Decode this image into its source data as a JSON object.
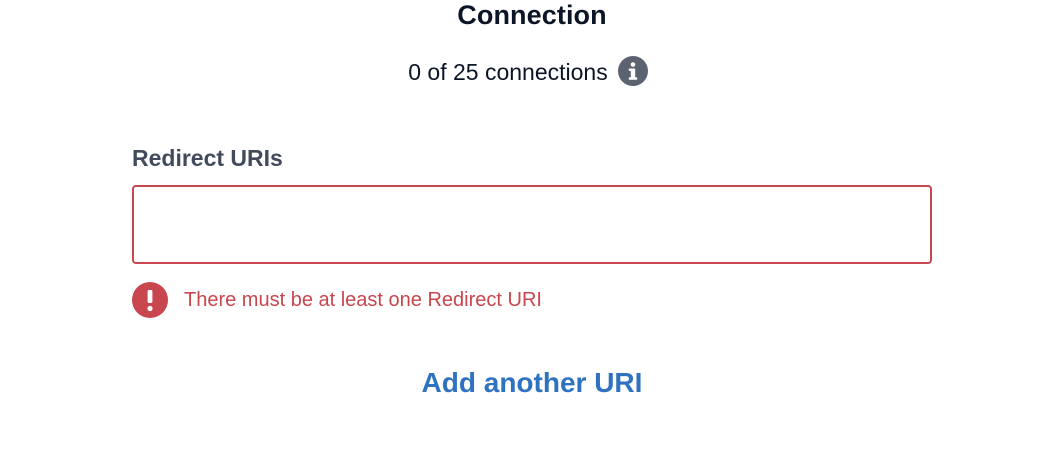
{
  "page": {
    "title": "Connection"
  },
  "usage": {
    "text": "0 of 25 connections",
    "icon": "info-icon"
  },
  "redirect_uris": {
    "label": "Redirect URIs",
    "value": "",
    "placeholder": "",
    "error": {
      "icon": "exclamation-circle-icon",
      "message": "There must be at least one Redirect URI"
    },
    "add_label": "Add another URI"
  },
  "colors": {
    "error": "#c8464d",
    "link": "#2f72c0",
    "label": "#414b5c",
    "title": "#0b1526",
    "info_icon": "#5c6370"
  }
}
